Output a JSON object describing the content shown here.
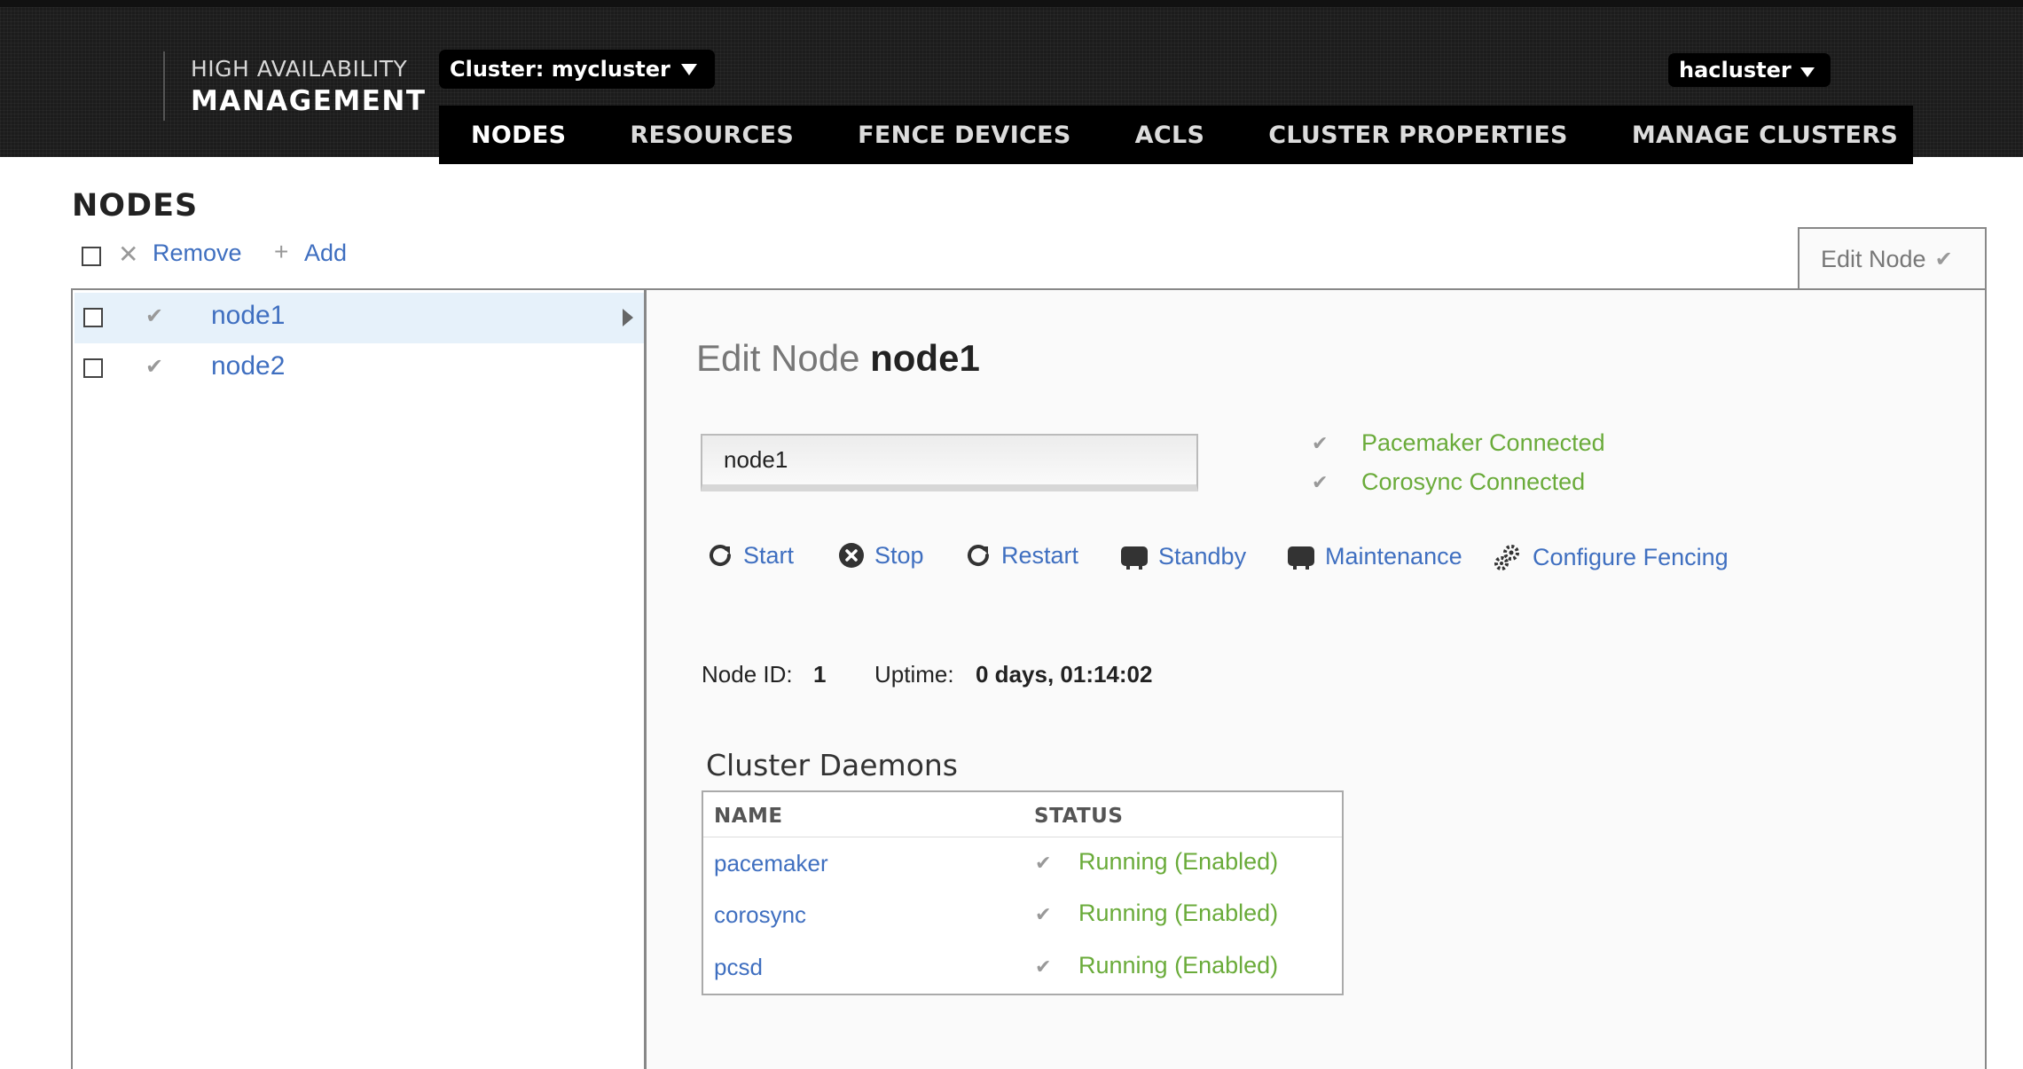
{
  "header": {
    "logo_top": "HIGH AVAILABILITY",
    "logo_bottom": "MANAGEMENT",
    "cluster_label": "Cluster: mycluster",
    "user_label": "hacluster",
    "nav": [
      "NODES",
      "RESOURCES",
      "FENCE DEVICES",
      "ACLS",
      "CLUSTER PROPERTIES",
      "MANAGE CLUSTERS"
    ],
    "active_nav": "NODES"
  },
  "page": {
    "title": "NODES",
    "toolbar": {
      "remove_label": "Remove",
      "add_label": "Add"
    },
    "edit_tab_label": "Edit Node"
  },
  "nodes": [
    {
      "name": "node1",
      "selected": true
    },
    {
      "name": "node2",
      "selected": false
    }
  ],
  "detail": {
    "title_prefix": "Edit Node",
    "title_node": "node1",
    "name_value": "node1",
    "status": [
      "Pacemaker Connected",
      "Corosync Connected"
    ],
    "actions": [
      "Start",
      "Stop",
      "Restart",
      "Standby",
      "Maintenance",
      "Configure Fencing"
    ],
    "node_id_label": "Node ID:",
    "node_id_value": "1",
    "uptime_label": "Uptime:",
    "uptime_value": "0 days, 01:14:02",
    "daemons_title": "Cluster Daemons",
    "daemons_columns": [
      "NAME",
      "STATUS"
    ],
    "daemons": [
      {
        "name": "pacemaker",
        "status": "Running (Enabled)"
      },
      {
        "name": "corosync",
        "status": "Running (Enabled)"
      },
      {
        "name": "pcsd",
        "status": "Running (Enabled)"
      }
    ]
  },
  "colors": {
    "link": "#3f6fc0",
    "ok": "#6aab3a",
    "header_bg": "#1c1c1c",
    "selected_row": "#e6f1fa"
  }
}
